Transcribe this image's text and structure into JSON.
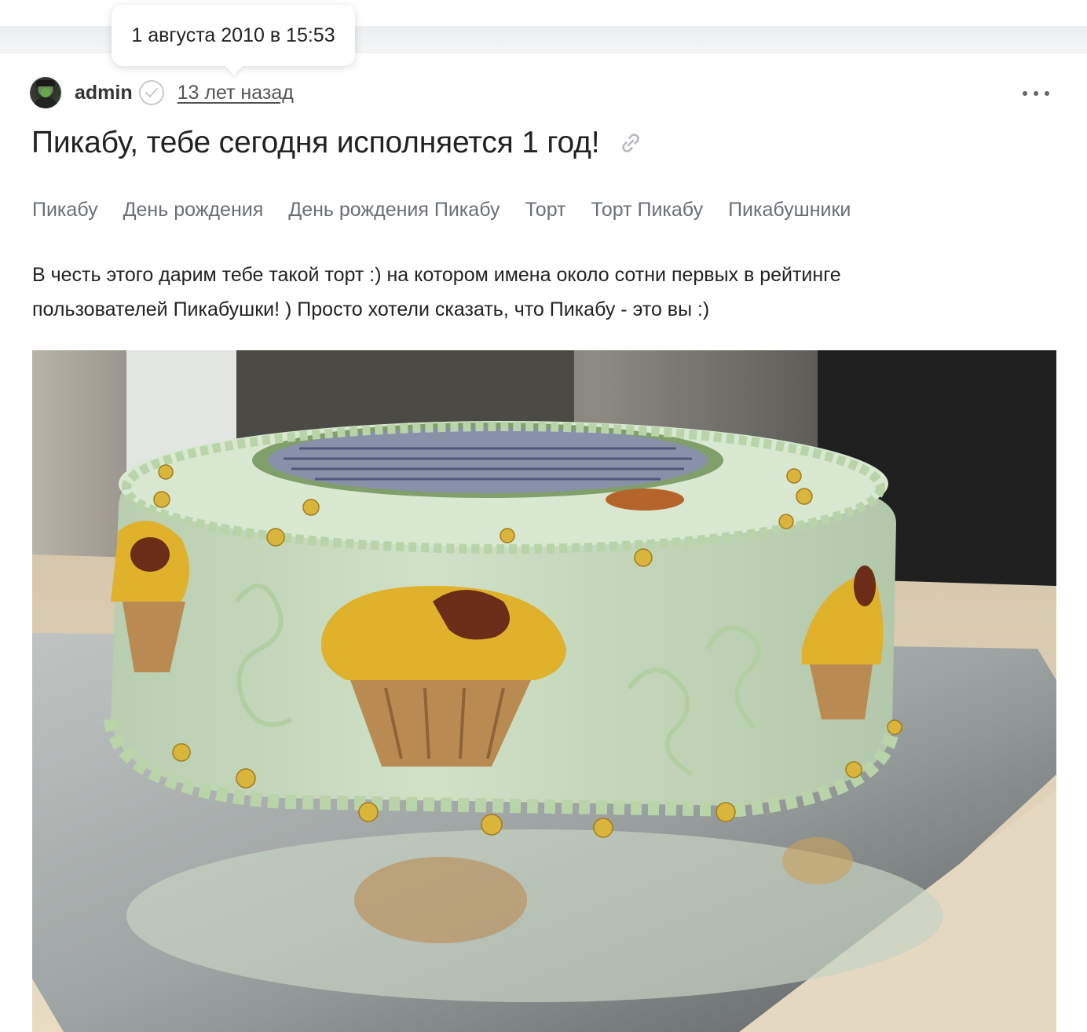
{
  "tooltip": {
    "text": "1 августа 2010 в 15:53"
  },
  "post": {
    "author": "admin",
    "time_ago": "13 лет назад",
    "title": "Пикабу, тебе сегодня исполняется 1 год!",
    "tags": [
      "Пикабу",
      "День рождения",
      "День рождения Пикабу",
      "Торт",
      "Торт Пикабу",
      "Пикабушники"
    ],
    "text_line1": "В честь этого дарим тебе такой торт :) на котором имена около сотни первых в рейтинге",
    "text_line2": "пользователей Пикабушки! ) Просто хотели сказать, что Пикабу - это вы :)"
  },
  "icons": {
    "verified": "check-circle-icon",
    "link": "link-icon",
    "more": "more-dots-icon"
  },
  "colors": {
    "tag_text": "#6b6f74",
    "cake_frosting": "#c9dcc0",
    "cupcake_top": "#e0b12a",
    "cupcake_base": "#b98a52"
  }
}
